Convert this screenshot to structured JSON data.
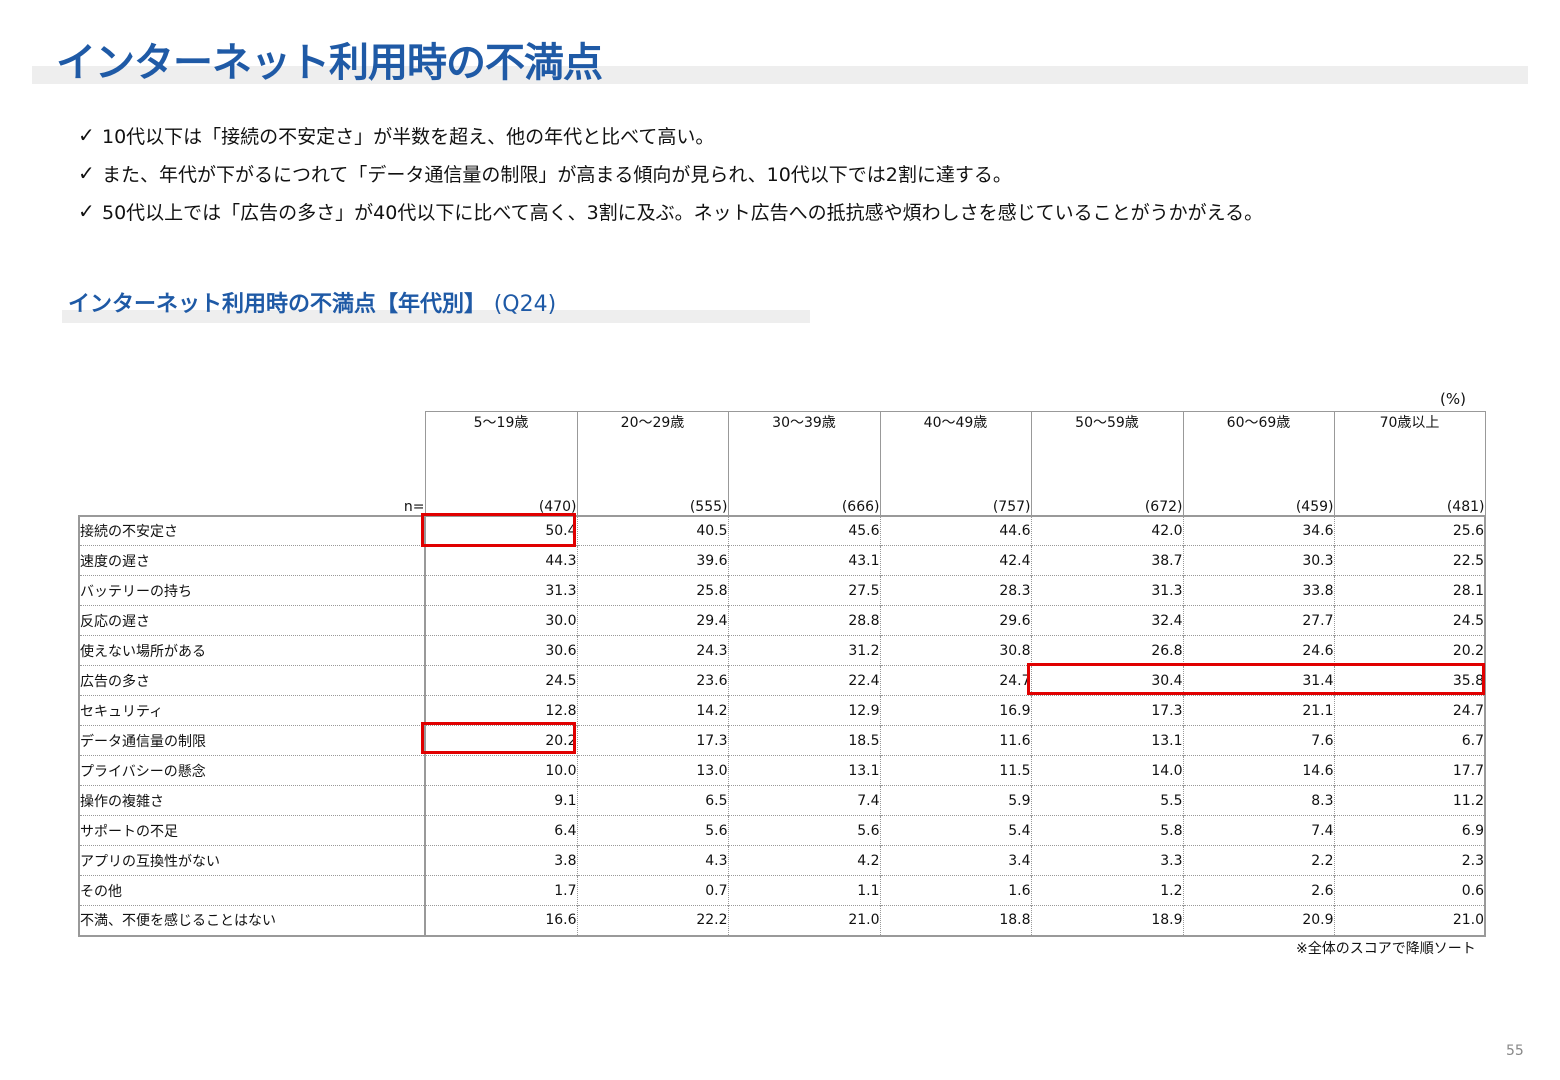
{
  "title": "インターネット利用時の不満点",
  "bullets": [
    "10代以下は「接続の不安定さ」が半数を超え、他の年代と比べて高い。",
    "また、年代が下がるにつれて「データ通信量の制限」が高まる傾向が見られ、10代以下では2割に達する。",
    "50代以上では「広告の多さ」が40代以下に比べて高く、3割に及ぶ。ネット広告への抵抗感や煩わしさを感じていることがうかがえる。"
  ],
  "check_mark": "✓",
  "subtitle": {
    "main": "インターネット利用時の不満点【年代別】",
    "question": "(Q24)"
  },
  "unit": "(%)",
  "table": {
    "n_label": "n=",
    "columns": [
      {
        "label": "5～19歳",
        "n": "(470)"
      },
      {
        "label": "20～29歳",
        "n": "(555)"
      },
      {
        "label": "30～39歳",
        "n": "(666)"
      },
      {
        "label": "40～49歳",
        "n": "(757)"
      },
      {
        "label": "50～59歳",
        "n": "(672)"
      },
      {
        "label": "60～69歳",
        "n": "(459)"
      },
      {
        "label": "70歳以上",
        "n": "(481)"
      }
    ],
    "rows": [
      {
        "label": "接続の不安定さ",
        "values": [
          "50.4",
          "40.5",
          "45.6",
          "44.6",
          "42.0",
          "34.6",
          "25.6"
        ]
      },
      {
        "label": "速度の遅さ",
        "values": [
          "44.3",
          "39.6",
          "43.1",
          "42.4",
          "38.7",
          "30.3",
          "22.5"
        ]
      },
      {
        "label": "バッテリーの持ち",
        "values": [
          "31.3",
          "25.8",
          "27.5",
          "28.3",
          "31.3",
          "33.8",
          "28.1"
        ]
      },
      {
        "label": "反応の遅さ",
        "values": [
          "30.0",
          "29.4",
          "28.8",
          "29.6",
          "32.4",
          "27.7",
          "24.5"
        ]
      },
      {
        "label": "使えない場所がある",
        "values": [
          "30.6",
          "24.3",
          "31.2",
          "30.8",
          "26.8",
          "24.6",
          "20.2"
        ]
      },
      {
        "label": "広告の多さ",
        "values": [
          "24.5",
          "23.6",
          "22.4",
          "24.7",
          "30.4",
          "31.4",
          "35.8"
        ]
      },
      {
        "label": "セキュリティ",
        "values": [
          "12.8",
          "14.2",
          "12.9",
          "16.9",
          "17.3",
          "21.1",
          "24.7"
        ]
      },
      {
        "label": "データ通信量の制限",
        "values": [
          "20.2",
          "17.3",
          "18.5",
          "11.6",
          "13.1",
          "7.6",
          "6.7"
        ]
      },
      {
        "label": "プライバシーの懸念",
        "values": [
          "10.0",
          "13.0",
          "13.1",
          "11.5",
          "14.0",
          "14.6",
          "17.7"
        ]
      },
      {
        "label": "操作の複雑さ",
        "values": [
          "9.1",
          "6.5",
          "7.4",
          "5.9",
          "5.5",
          "8.3",
          "11.2"
        ]
      },
      {
        "label": "サポートの不足",
        "values": [
          "6.4",
          "5.6",
          "5.6",
          "5.4",
          "5.8",
          "7.4",
          "6.9"
        ]
      },
      {
        "label": "アプリの互換性がない",
        "values": [
          "3.8",
          "4.3",
          "4.2",
          "3.4",
          "3.3",
          "2.2",
          "2.3"
        ]
      },
      {
        "label": "その他",
        "values": [
          "1.7",
          "0.7",
          "1.1",
          "1.6",
          "1.2",
          "2.6",
          "0.6"
        ]
      },
      {
        "label": "不満、不便を感じることはない",
        "values": [
          "16.6",
          "22.2",
          "21.0",
          "18.8",
          "18.9",
          "20.9",
          "21.0"
        ]
      }
    ]
  },
  "highlight_color": "#e00000",
  "note": "※全体のスコアで降順ソート",
  "page_number": "55"
}
